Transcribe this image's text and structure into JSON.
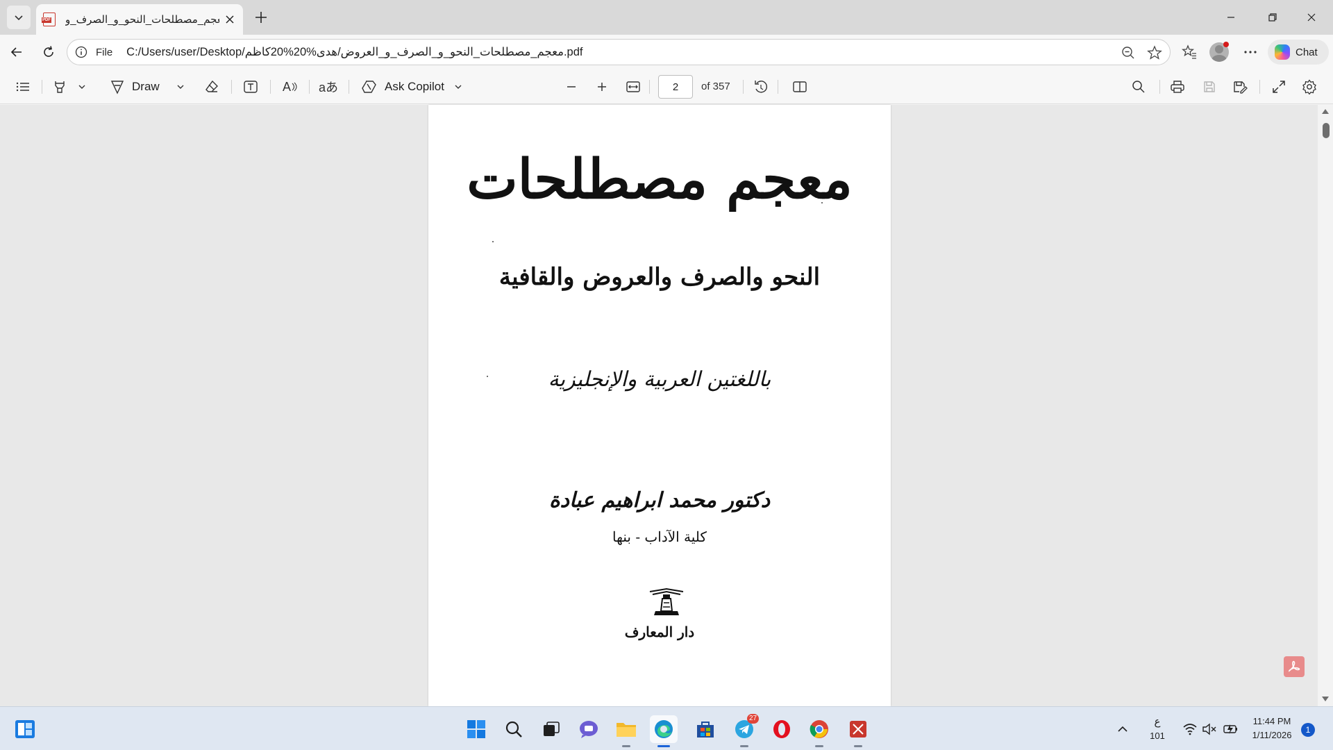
{
  "browser": {
    "tab": {
      "title": "معجم_مصطلحات_النحو_و_الصرف_و",
      "favicon_text": "PDF"
    },
    "address": {
      "scheme_label": "File",
      "url": "C:/Users/user/Desktop/معجم_مصطلحات_النحو_و_الصرف_و_العروض/هدى%20%20كاظم.pdf"
    },
    "chat_label": "Chat"
  },
  "pdf_toolbar": {
    "draw_label": "Draw",
    "ask_copilot_label": "Ask Copilot",
    "translate_glyph": "aあ",
    "read_aloud_glyph": "A",
    "page_current": "2",
    "page_total": "of 357"
  },
  "document": {
    "title": "معجم مصطلحات",
    "subtitle": "النحو والصرف والعروض والقافية",
    "languages": "باللغتين العربية والإنجليزية",
    "author": "دكتور محمد ابراهيم عبادة",
    "affiliation": "كلية الآداب - بنها",
    "publisher": "دار المعارف"
  },
  "taskbar": {
    "telegram_badge": "27",
    "language_indicator": "ع",
    "language_sub": "101",
    "clock_time": "11:44 PM",
    "clock_date": "1/11/2026",
    "notification_count": "1"
  },
  "colors": {
    "tab_strip": "#d9d9d9",
    "toolbar": "#f7f7f7",
    "viewer_bg": "#e8e8e8",
    "taskbar": "#dfe7f2",
    "accent_blue": "#1a63d8",
    "pdf_red": "#c8372d"
  }
}
